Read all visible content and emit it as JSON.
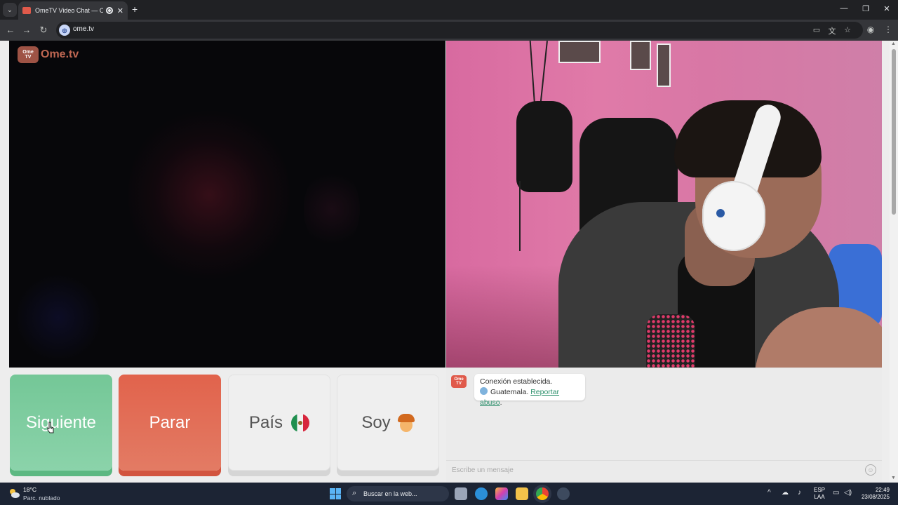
{
  "browser": {
    "tab_title": "OmeTV Video Chat — OmeTV",
    "url": "ome.tv",
    "new_tab": "+",
    "close": "✕"
  },
  "logo": {
    "tv_badge_top": "Ome",
    "tv_badge_bottom": "TV",
    "text": "Ome.tv"
  },
  "controls": {
    "next": "Siguiente",
    "stop": "Parar",
    "country": "País",
    "gender": "Soy"
  },
  "chat": {
    "status": "Conexión establecida.",
    "country": "Guatemala.",
    "report": "Reportar abuso",
    "report_suffix": ".",
    "placeholder": "Escribe un mensaje",
    "emoji": "☺"
  },
  "taskbar": {
    "temperature": "18°C",
    "weather": "Parc. nublado",
    "search": "Buscar en la web...",
    "lang_top": "ESP",
    "lang_bottom": "LAA",
    "time": "22:49",
    "date": "23/08/2025"
  },
  "colors": {
    "next": "#74c797",
    "stop": "#e1634c",
    "accent_link": "#2a8f6a"
  }
}
